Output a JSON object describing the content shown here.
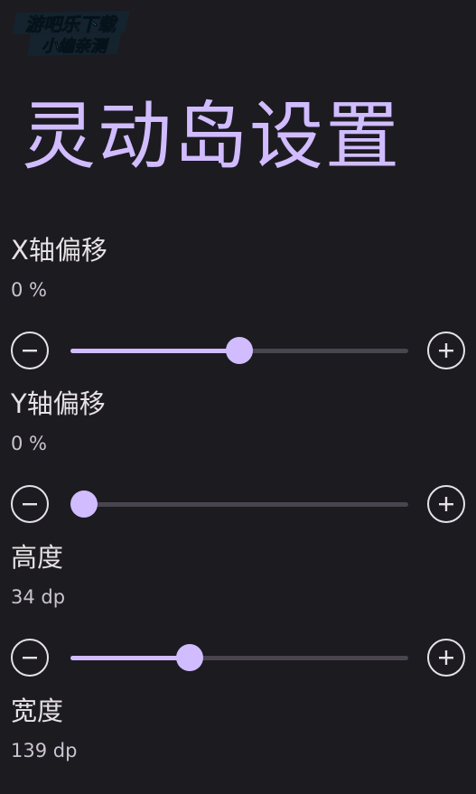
{
  "watermark": {
    "line1": "游吧乐下载",
    "line2": "小编亲测"
  },
  "title": "灵动岛设置",
  "colors": {
    "background": "#1c1b20",
    "accent": "#d0bcff",
    "track": "#49454f",
    "text": "#e6e1e5",
    "subtext": "#cac4d0"
  },
  "icons": {
    "minus": "minus-circle-icon",
    "plus": "plus-circle-icon"
  },
  "settings": [
    {
      "label": "X轴偏移",
      "value": "0 %",
      "level": 0.5
    },
    {
      "label": "Y轴偏移",
      "value": "0 %",
      "level": 0.0
    },
    {
      "label": "高度",
      "value": "34 dp",
      "level": 0.34
    },
    {
      "label": "宽度",
      "value": "139 dp"
    }
  ]
}
